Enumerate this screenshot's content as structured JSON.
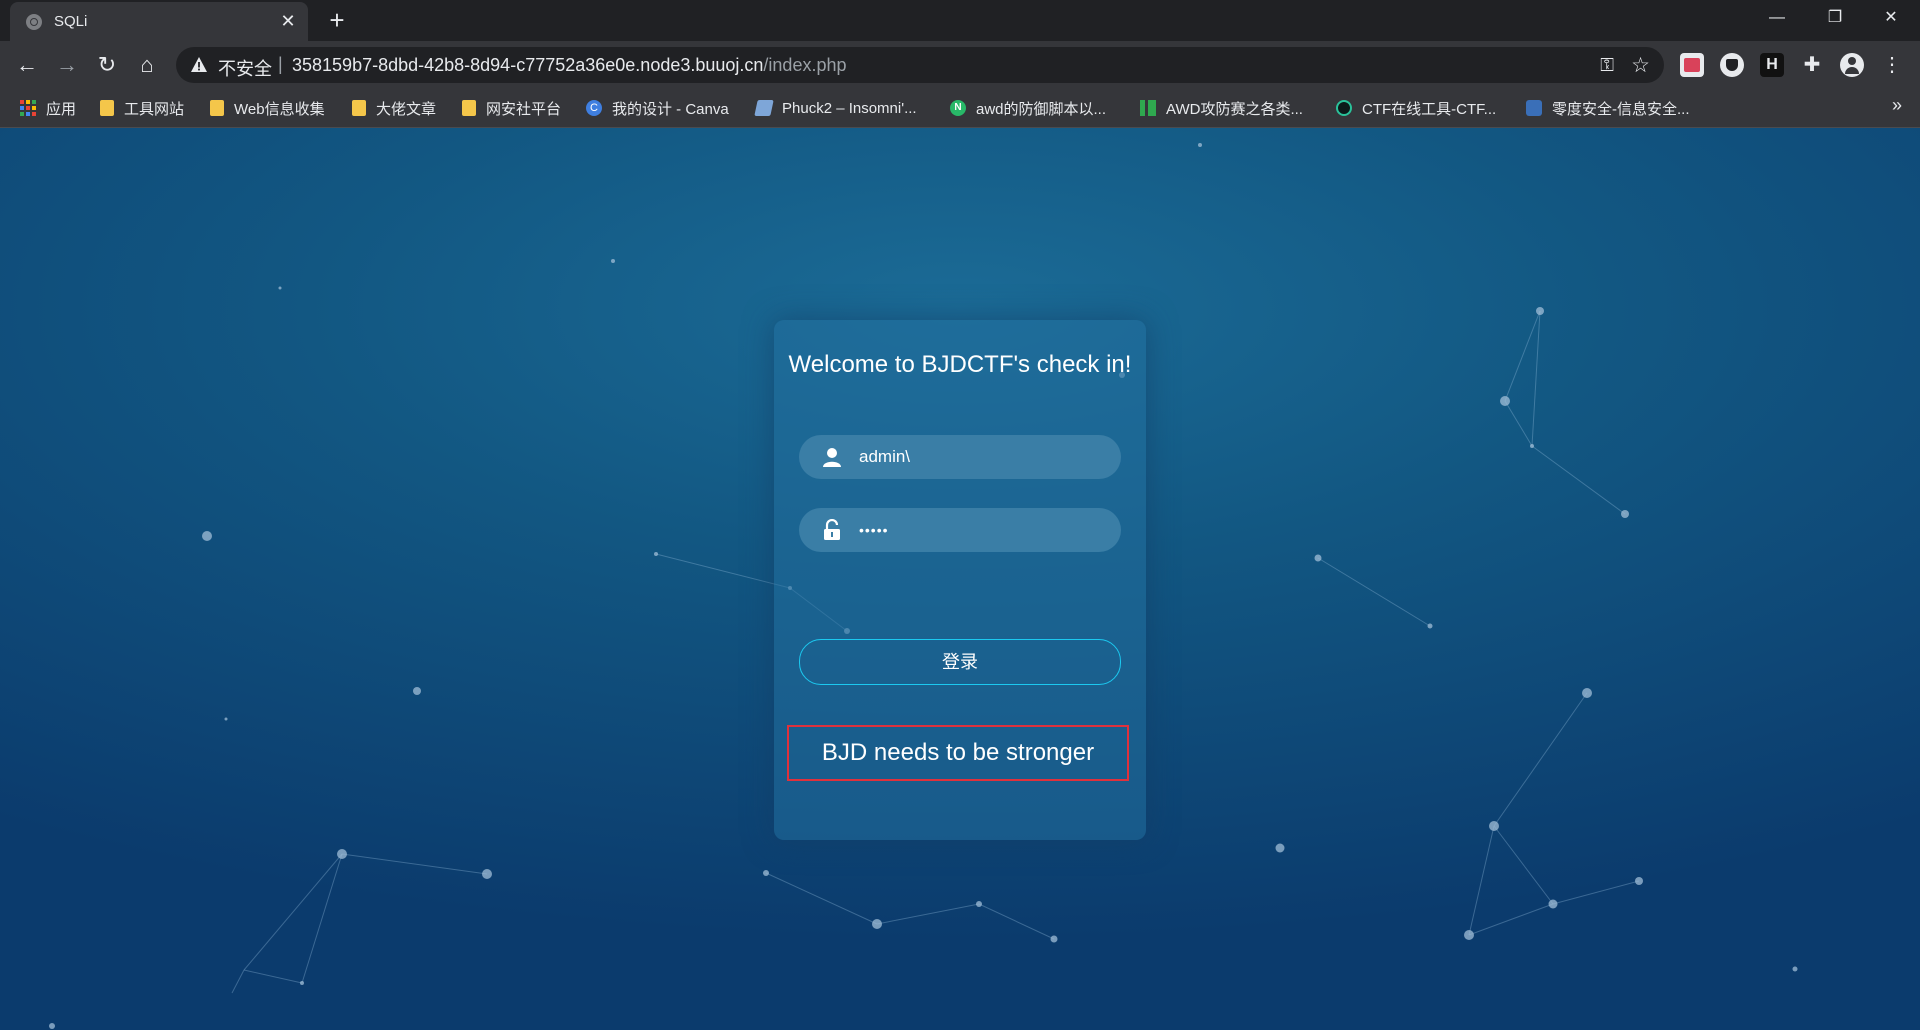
{
  "browser": {
    "tab": {
      "title": "SQLi",
      "close": "✕"
    },
    "new_tab": "+",
    "window_controls": {
      "minimize": "—",
      "restore": "❐",
      "close": "✕"
    },
    "nav": {
      "back": "←",
      "forward": "→",
      "reload": "↻",
      "home": "⌂"
    },
    "address": {
      "security_label": "不安全",
      "separator": "|",
      "host": "358159b7-8dbd-42b8-8d94-c77752a36e0e.node3.buuoj.cn",
      "path": "/index.php",
      "key_icon": "⚿",
      "star_icon": "☆"
    },
    "bookmarks": [
      {
        "label": "应用",
        "icon": "apps-grid-icon"
      },
      {
        "label": "工具网站",
        "icon": "folder-icon"
      },
      {
        "label": "Web信息收集",
        "icon": "folder-icon"
      },
      {
        "label": "大佬文章",
        "icon": "folder-icon"
      },
      {
        "label": "网安社平台",
        "icon": "folder-icon"
      },
      {
        "label": "我的设计 - Canva",
        "icon": "canva-icon"
      },
      {
        "label": "Phuck2 – Insomni'...",
        "icon": "page-icon"
      },
      {
        "label": "awd的防御脚本以...",
        "icon": "n-icon"
      },
      {
        "label": "AWD攻防赛之各类...",
        "icon": "green-bars-icon"
      },
      {
        "label": "CTF在线工具-CTF...",
        "icon": "dark-circle-icon"
      },
      {
        "label": "零度安全-信息安全...",
        "icon": "zero-security-icon"
      }
    ],
    "bookmarks_more": "»"
  },
  "login": {
    "welcome": "Welcome to BJDCTF's check in!",
    "username_value": "admin\\",
    "password_value": "•••••",
    "submit_label": "登录",
    "message": "BJD needs to be stronger"
  },
  "colors": {
    "frame": "#202124",
    "toolbar": "#35363a",
    "bg_top": "#1b6b96",
    "bg_bottom": "#0b3b6d",
    "login_border": "#1cc9f0",
    "message_border": "#e0313c"
  }
}
